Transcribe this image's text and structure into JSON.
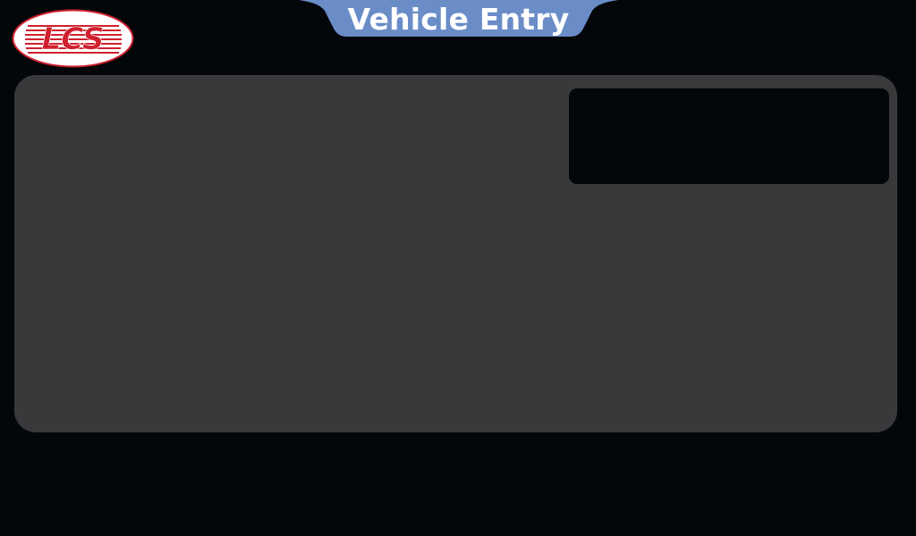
{
  "header": {
    "logo_text": "LCS",
    "title": "Vehicle Entry"
  },
  "colors": {
    "background": "#04070a",
    "panel": "#39393b",
    "display_box": "#04070a",
    "title_tab": "#6a8dc8",
    "logo_red": "#d0202e"
  },
  "icons": {
    "logo": "lcs-logo-icon"
  }
}
